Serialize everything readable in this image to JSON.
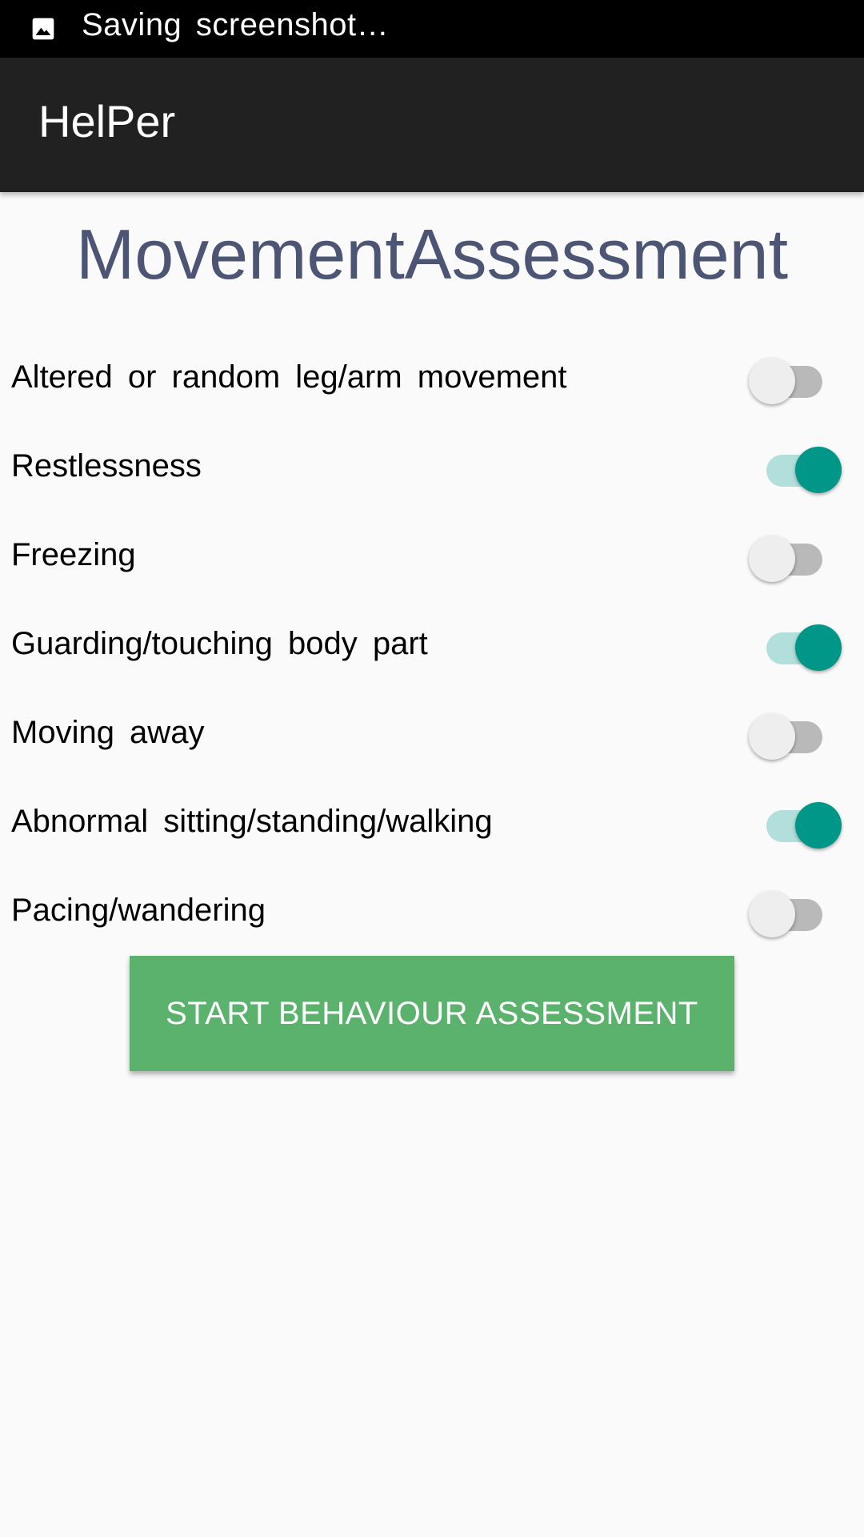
{
  "status_bar": {
    "notification_icon": "image-icon",
    "text": "Saving screenshot…"
  },
  "app_bar": {
    "title": "HelPer"
  },
  "page": {
    "title": "MovementAssessment"
  },
  "items": [
    {
      "label": "Altered or random leg/arm movement",
      "checked": false
    },
    {
      "label": "Restlessness",
      "checked": true
    },
    {
      "label": "Freezing",
      "checked": false
    },
    {
      "label": "Guarding/touching body part",
      "checked": true
    },
    {
      "label": "Moving away",
      "checked": false
    },
    {
      "label": "Abnormal sitting/standing/walking",
      "checked": true
    },
    {
      "label": "Pacing/wandering",
      "checked": false
    }
  ],
  "button": {
    "label": "START BEHAVIOUR ASSESSMENT"
  },
  "colors": {
    "accent": "#009688",
    "accent_track": "#b2dfdb",
    "button": "#5bb26d",
    "title": "#4c5573",
    "app_bar": "#212121"
  }
}
